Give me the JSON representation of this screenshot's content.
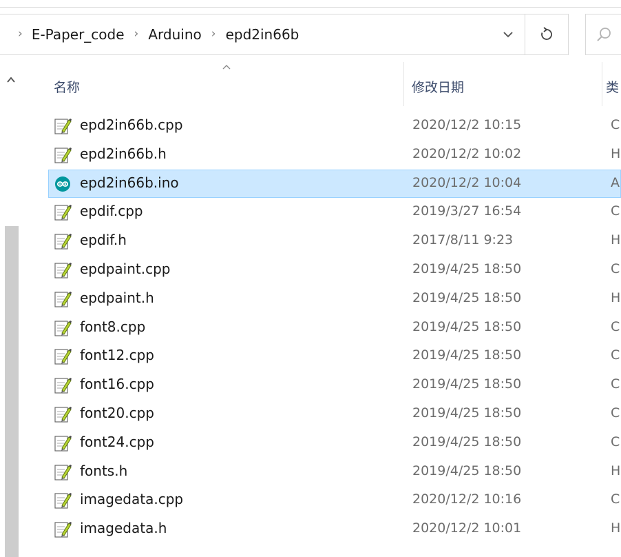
{
  "address_bar": {
    "breadcrumbs": [
      "E-Paper_code",
      "Arduino",
      "epd2in66b"
    ],
    "separator": "›",
    "dropdown_icon": "chevron-down-icon",
    "refresh_icon": "refresh-icon"
  },
  "search": {
    "icon": "search-icon"
  },
  "columns": {
    "name": "名称",
    "date_modified": "修改日期",
    "type": "类"
  },
  "files": [
    {
      "name": "epd2in66b.cpp",
      "date": "2020/12/2 10:15",
      "type": "C",
      "icon": "text-file-icon",
      "selected": false
    },
    {
      "name": "epd2in66b.h",
      "date": "2020/12/2 10:02",
      "type": "H",
      "icon": "text-file-icon",
      "selected": false
    },
    {
      "name": "epd2in66b.ino",
      "date": "2020/12/2 10:04",
      "type": "A",
      "icon": "arduino-icon",
      "selected": true
    },
    {
      "name": "epdif.cpp",
      "date": "2019/3/27 16:54",
      "type": "C",
      "icon": "text-file-icon",
      "selected": false
    },
    {
      "name": "epdif.h",
      "date": "2017/8/11 9:23",
      "type": "H",
      "icon": "text-file-icon",
      "selected": false
    },
    {
      "name": "epdpaint.cpp",
      "date": "2019/4/25 18:50",
      "type": "C",
      "icon": "text-file-icon",
      "selected": false
    },
    {
      "name": "epdpaint.h",
      "date": "2019/4/25 18:50",
      "type": "H",
      "icon": "text-file-icon",
      "selected": false
    },
    {
      "name": "font8.cpp",
      "date": "2019/4/25 18:50",
      "type": "C",
      "icon": "text-file-icon",
      "selected": false
    },
    {
      "name": "font12.cpp",
      "date": "2019/4/25 18:50",
      "type": "C",
      "icon": "text-file-icon",
      "selected": false
    },
    {
      "name": "font16.cpp",
      "date": "2019/4/25 18:50",
      "type": "C",
      "icon": "text-file-icon",
      "selected": false
    },
    {
      "name": "font20.cpp",
      "date": "2019/4/25 18:50",
      "type": "C",
      "icon": "text-file-icon",
      "selected": false
    },
    {
      "name": "font24.cpp",
      "date": "2019/4/25 18:50",
      "type": "C",
      "icon": "text-file-icon",
      "selected": false
    },
    {
      "name": "fonts.h",
      "date": "2019/4/25 18:50",
      "type": "H",
      "icon": "text-file-icon",
      "selected": false
    },
    {
      "name": "imagedata.cpp",
      "date": "2020/12/2 10:16",
      "type": "C",
      "icon": "text-file-icon",
      "selected": false
    },
    {
      "name": "imagedata.h",
      "date": "2020/12/2 10:01",
      "type": "H",
      "icon": "text-file-icon",
      "selected": false
    }
  ],
  "colors": {
    "selection_background": "#cce8ff",
    "selection_border": "#99d1ff",
    "header_text": "#3c4b6b",
    "date_text": "#6d6d6d",
    "arduino_teal": "#00979d"
  }
}
